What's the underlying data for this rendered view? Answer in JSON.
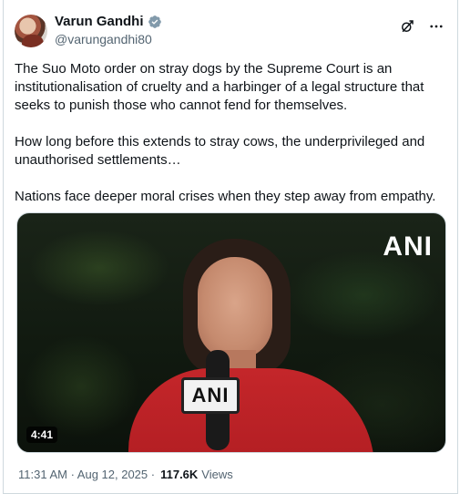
{
  "author": {
    "name": "Varun Gandhi",
    "handle": "@varungandhi80",
    "verified_badge_color": "#829aab"
  },
  "actions": {
    "grok_icon": "grok-icon",
    "more_icon": "more-icon"
  },
  "post": {
    "paragraphs": [
      "The Suo Moto order on stray dogs by the Supreme Court is an institutionalisation of cruelty and a harbinger of a legal structure that seeks to punish those who cannot fend for themselves.",
      "How long before this extends to stray cows, the underprivileged and unauthorised settlements…",
      "Nations face deeper moral crises when they step away from empathy."
    ]
  },
  "media": {
    "type": "video",
    "watermark": "ANI",
    "mic_label": "ANI",
    "duration": "4:41"
  },
  "meta": {
    "timestamp": "11:31 AM · Aug 12, 2025 · ",
    "views_count": "117.6K",
    "views_label": "Views"
  },
  "colors": {
    "text": "#0f1419",
    "secondary": "#536471",
    "border": "#cfd9de"
  }
}
